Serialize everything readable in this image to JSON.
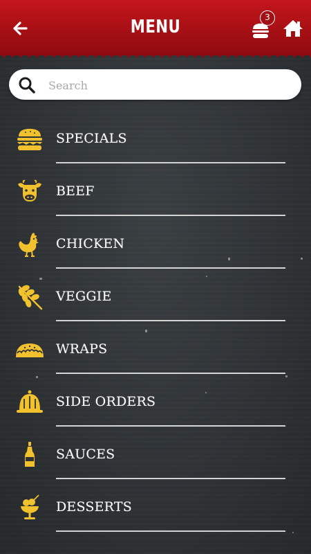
{
  "colors": {
    "header_red": "#b5121b",
    "icon_yellow": "#f2c12e",
    "label_white": "#ffffff",
    "board_dark": "#2f3336"
  },
  "header": {
    "title": "MENU",
    "back_icon": "back-arrow-icon",
    "cart_icon": "burger-cart-icon",
    "cart_count": "3",
    "home_icon": "home-icon"
  },
  "search": {
    "placeholder": "Search",
    "value": ""
  },
  "menu": {
    "items": [
      {
        "label": "SPECIALS",
        "icon": "burger-icon"
      },
      {
        "label": "BEEF",
        "icon": "cow-icon"
      },
      {
        "label": "CHICKEN",
        "icon": "chicken-icon"
      },
      {
        "label": "VEGGIE",
        "icon": "wheat-icon"
      },
      {
        "label": "WRAPS",
        "icon": "taco-icon"
      },
      {
        "label": "SIDE ORDERS",
        "icon": "side-dish-icon"
      },
      {
        "label": "SAUCES",
        "icon": "sauce-bottle-icon"
      },
      {
        "label": "DESSERTS",
        "icon": "sundae-icon"
      }
    ]
  }
}
